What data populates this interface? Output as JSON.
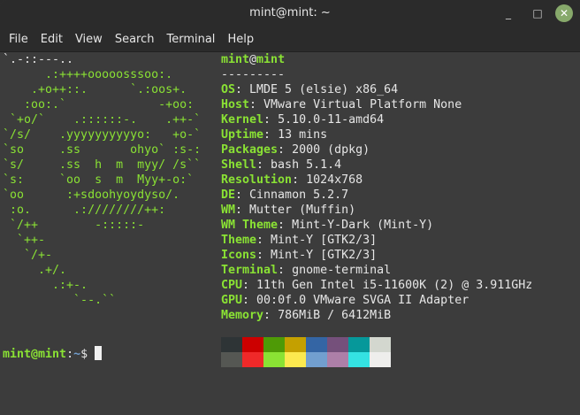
{
  "window": {
    "title": "mint@mint: ~",
    "minimize": "_",
    "maximize": "□",
    "close": "✕"
  },
  "menu": [
    "File",
    "Edit",
    "View",
    "Search",
    "Terminal",
    "Help"
  ],
  "art": [
    "`.-::---..",
    "      .:++++ooooosssoo:.",
    "    .+o++::.      `.:oos+.",
    "   :oo:.`             -+oo:",
    " `+o/`    .::::::-.    .++-`",
    "`/s/    .yyyyyyyyyyo:   +o-`",
    "`so     .ss       ohyo` :s-:",
    "`s/     .ss  h  m  myy/ /s``",
    "`s:     `oo  s  m  Myy+-o:`",
    "`oo      :+sdoohyoydyso/.",
    " :o.      .:////////++:",
    " `/++        -:::::-",
    "  `++-",
    "   `/+-",
    "     .+/.",
    "       .:+-.",
    "          `--.``"
  ],
  "info": {
    "user": "mint",
    "at": "@",
    "host": "mint",
    "separator": "---------",
    "rows": [
      {
        "key": "OS",
        "value": "LMDE 5 (elsie) x86_64"
      },
      {
        "key": "Host",
        "value": "VMware Virtual Platform None"
      },
      {
        "key": "Kernel",
        "value": "5.10.0-11-amd64"
      },
      {
        "key": "Uptime",
        "value": "13 mins"
      },
      {
        "key": "Packages",
        "value": "2000 (dpkg)"
      },
      {
        "key": "Shell",
        "value": "bash 5.1.4"
      },
      {
        "key": "Resolution",
        "value": "1024x768"
      },
      {
        "key": "DE",
        "value": "Cinnamon 5.2.7"
      },
      {
        "key": "WM",
        "value": "Mutter (Muffin)"
      },
      {
        "key": "WM Theme",
        "value": "Mint-Y-Dark (Mint-Y)"
      },
      {
        "key": "Theme",
        "value": "Mint-Y [GTK2/3]"
      },
      {
        "key": "Icons",
        "value": "Mint-Y [GTK2/3]"
      },
      {
        "key": "Terminal",
        "value": "gnome-terminal"
      },
      {
        "key": "CPU",
        "value": "11th Gen Intel i5-11600K (2) @ 3.911GHz"
      },
      {
        "key": "GPU",
        "value": "00:0f.0 VMware SVGA II Adapter"
      },
      {
        "key": "Memory",
        "value": "786MiB / 6412MiB"
      }
    ]
  },
  "palette": [
    "#2e3436",
    "#cc0000",
    "#4e9a06",
    "#c4a000",
    "#3465a4",
    "#75507b",
    "#06989a",
    "#d3d7cf",
    "#555753",
    "#ef2929",
    "#8ae234",
    "#fce94f",
    "#729fcf",
    "#ad7fa8",
    "#34e2e2",
    "#eeeeec"
  ],
  "prompt": {
    "user": "mint@mint",
    "sep": ":",
    "path": "~",
    "symbol": "$ "
  }
}
